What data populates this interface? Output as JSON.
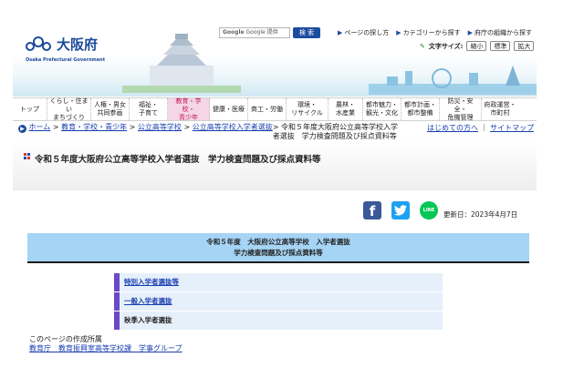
{
  "header": {
    "logo_text": "大阪府",
    "logo_sub": "Osaka Prefectural Government",
    "search_placeholder": "Google 提供",
    "search_button": "検 索",
    "toplinks": [
      "ページの探し方",
      "カテゴリーから探す",
      "府庁の組織から探す"
    ],
    "fontsize_label": "文字サイズ:",
    "fontsize_buttons": [
      "縮小",
      "標準",
      "拡大"
    ]
  },
  "nav": {
    "items": [
      "トップ",
      "くらし・住まい\nまちづくり",
      "人権・男女\n共同参画",
      "福祉・\n子育て",
      "教育・学校・\n青少年",
      "健康・医療",
      "商工・労働",
      "環境・\nリサイクル",
      "農林・\n水産業",
      "都市魅力・\n観光・文化",
      "都市計画・\n都市整備",
      "防災・安全・\n危機管理",
      "府政運営・\n市町村"
    ]
  },
  "breadcrumb": {
    "home": "ホーム",
    "sep": " > ",
    "l1": "教育・学校・青少年",
    "l2": "公立高等学校",
    "l3": "公立高等学校入学者選抜",
    "current": " > 令和５年度大阪府公立高等学校入学者選抜　学力検査問題及び採点資料等",
    "intro": "はじめての方へ",
    "sitemap": "サイトマップ",
    "divider": "｜"
  },
  "page": {
    "title": "令和５年度大阪府公立高等学校入学者選抜　学力検査問題及び採点資料等",
    "updated": "更新日：2023年4月7日",
    "heading_line1": "令和５年度　大阪府公立高等学校　入学者選抜",
    "heading_line2": "学力検査問題及び採点資料等",
    "list": [
      {
        "label": "特別入学者選抜等",
        "link": true
      },
      {
        "label": "一般入学者選抜",
        "link": true
      },
      {
        "label": "秋季入学者選抜",
        "link": false
      }
    ],
    "author_label": "このページの作成所属",
    "author_link": "教育庁　教育振興室高等学校課　学事グループ"
  },
  "social": {
    "facebook": "f",
    "twitter": "🐦",
    "line": "LINE"
  },
  "colors": {
    "brand": "#1c4c9f",
    "nav_active_bg": "#f4d6e6",
    "nav_active_text": "#c2185b",
    "heading_bg": "#a6d4f5",
    "list_border": "#6a48c8",
    "list_bg": "#e6f0fb"
  }
}
